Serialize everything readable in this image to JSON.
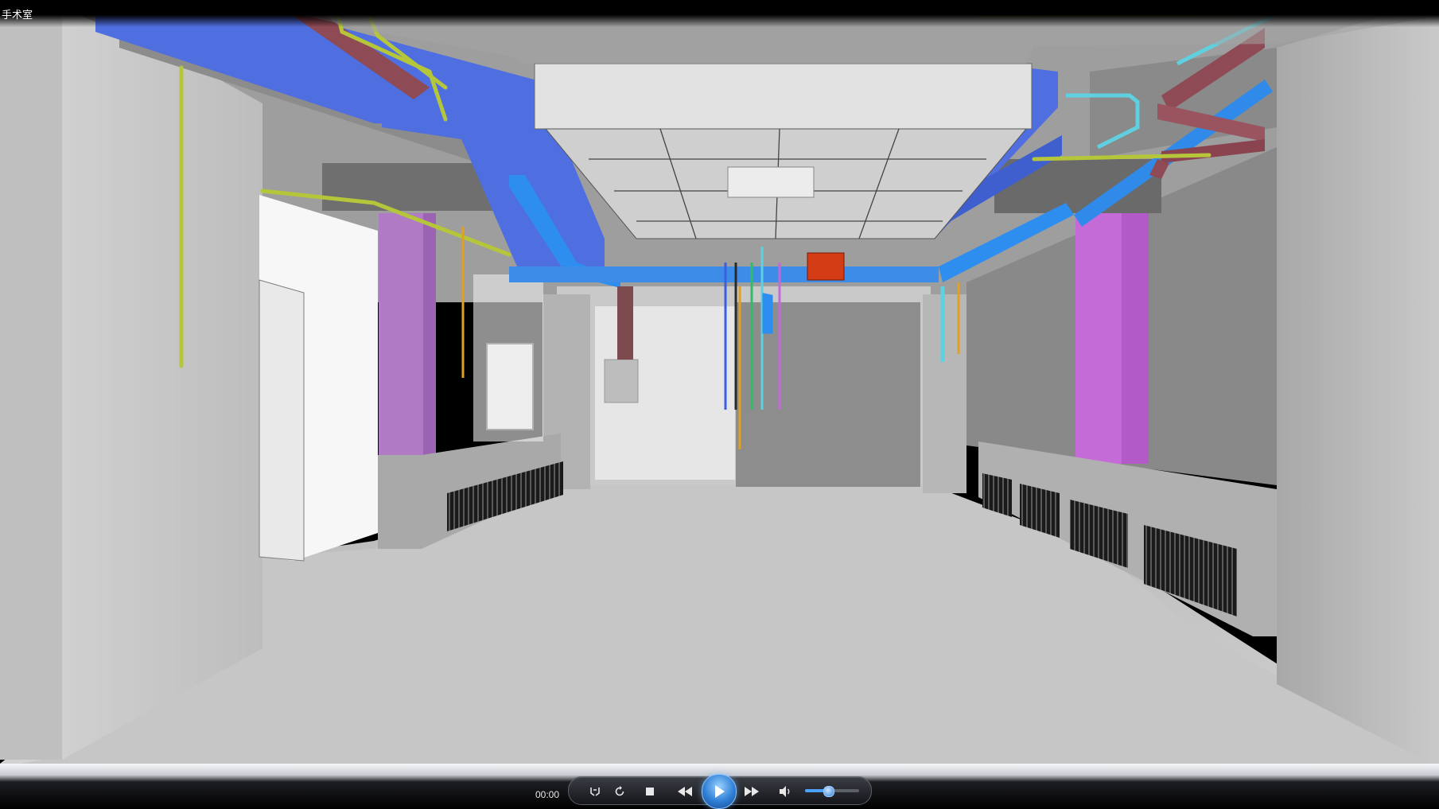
{
  "window": {
    "title": "手术室"
  },
  "player": {
    "time": "00:00",
    "volume_level": 0.42,
    "icons": {
      "switch_view": "switch-view-icon",
      "repeat": "repeat-icon",
      "stop": "stop-icon",
      "rewind": "rewind-icon",
      "play": "play-icon",
      "fast_forward": "fast-forward-icon",
      "volume": "volume-icon"
    }
  },
  "colors": {
    "supply_duct": "#4f6ee0",
    "ductwork_blue": "#2e8ef0",
    "return_duct": "#8e4a55",
    "column": "#c46bd8",
    "gas_pipe_yellow": "#b6c63a",
    "pipe_cyan": "#5fd0e0",
    "equipment_red": "#d43c16",
    "accent_blue": "#2f7fd6"
  }
}
